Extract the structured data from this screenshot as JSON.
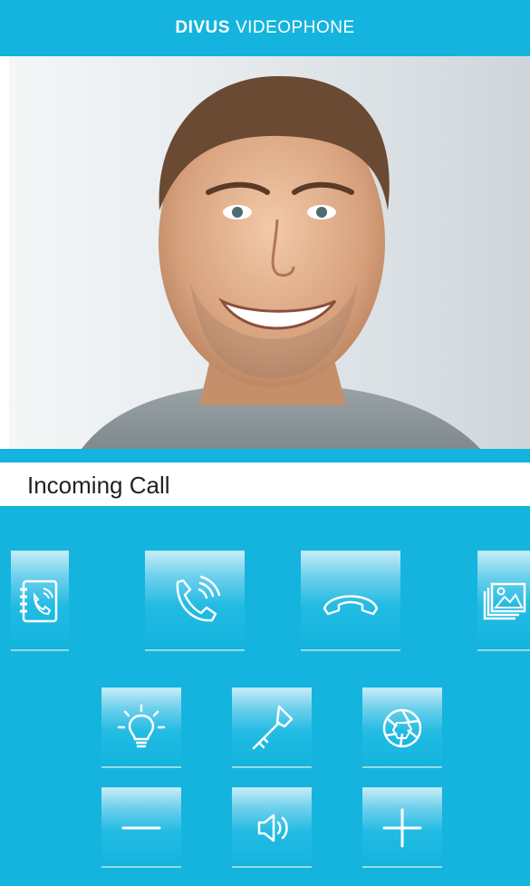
{
  "header": {
    "brand": "DIVUS",
    "product": "VIDEOPHONE"
  },
  "video": {
    "content": "caller-video-feed"
  },
  "status": {
    "text": "Incoming Call"
  },
  "colors": {
    "accent": "#14b4de",
    "text": "#222222",
    "icon": "#ffffff"
  },
  "controls": {
    "top_row": [
      "phonebook-icon",
      "answer-call-icon",
      "hang-up-icon",
      "gallery-icon"
    ],
    "middle_row": [
      "light-icon",
      "door-key-icon",
      "camera-shutter-icon"
    ],
    "bottom_row": [
      "volume-down-icon",
      "speaker-icon",
      "volume-up-icon"
    ]
  }
}
